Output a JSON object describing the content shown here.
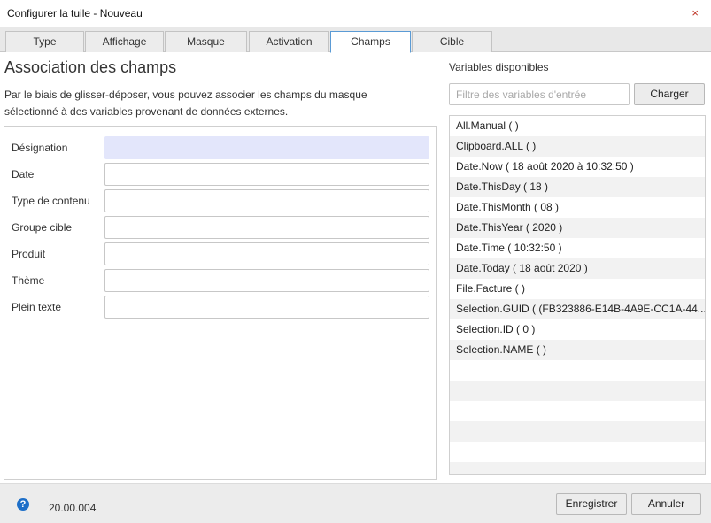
{
  "window": {
    "title": "Configurer la tuile - Nouveau",
    "close_glyph": "×"
  },
  "tabs": [
    {
      "label": "Type",
      "active": false
    },
    {
      "label": "Affichage",
      "active": false
    },
    {
      "label": "Masque",
      "active": false
    },
    {
      "label": "Activation",
      "active": false
    },
    {
      "label": "Champs",
      "active": true
    },
    {
      "label": "Cible",
      "active": false
    }
  ],
  "mapping": {
    "title": "Association des champs",
    "description": "Par le biais de glisser-déposer, vous pouvez associer les champs du masque sélectionné à des variables provenant de données externes.",
    "fields": [
      {
        "label": "Désignation",
        "value": "",
        "highlighted": true
      },
      {
        "label": "Date",
        "value": ""
      },
      {
        "label": "Type de contenu",
        "value": ""
      },
      {
        "label": "Groupe cible",
        "value": ""
      },
      {
        "label": "Produit",
        "value": ""
      },
      {
        "label": "Thème",
        "value": ""
      },
      {
        "label": "Plein texte",
        "value": ""
      }
    ]
  },
  "variables": {
    "title": "Variables disponibles",
    "filter_placeholder": "Filtre des variables d'entrée",
    "load_button": "Charger",
    "items": [
      "All.Manual (  )",
      "Clipboard.ALL (  )",
      "Date.Now ( 18 août 2020 à 10:32:50 )",
      "Date.ThisDay ( 18 )",
      "Date.ThisMonth ( 08 )",
      "Date.ThisYear ( 2020 )",
      "Date.Time ( 10:32:50 )",
      "Date.Today ( 18 août 2020 )",
      "File.Facture (  )",
      "Selection.GUID ( (FB323886-E14B-4A9E-CC1A-44... )",
      "Selection.ID ( 0 )",
      "Selection.NAME (  )"
    ]
  },
  "footer": {
    "help_glyph": "?",
    "version": "20.00.004",
    "save_button": "Enregistrer",
    "cancel_button": "Annuler"
  },
  "colors": {
    "accent": "#5b9bd5",
    "highlight_field": "#e3e6fb",
    "help_icon": "#1e6fc8",
    "close_icon": "#c0392b"
  }
}
